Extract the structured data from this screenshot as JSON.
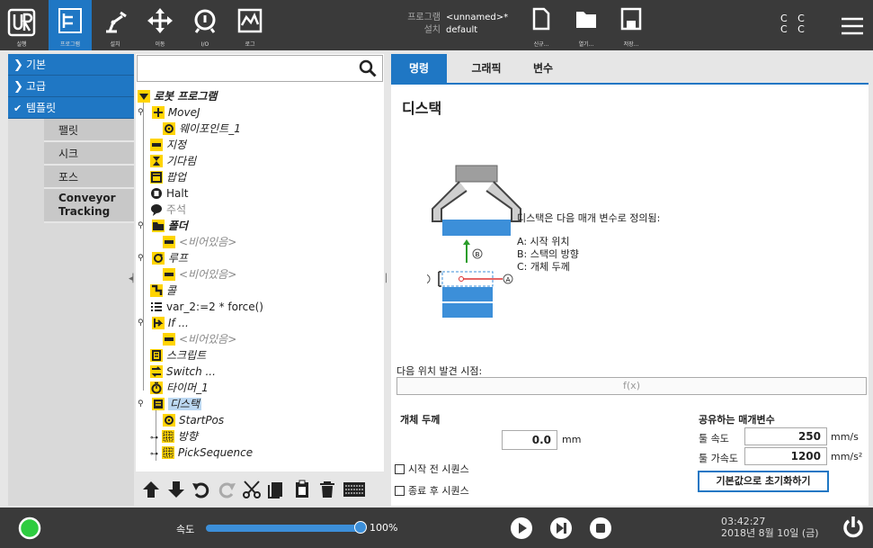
{
  "topbar": {
    "nav": [
      {
        "label": "실행",
        "icon": "ur-logo-icon"
      },
      {
        "label": "프로그램",
        "icon": "program-tree-icon"
      },
      {
        "label": "설치",
        "icon": "robot-arm-icon"
      },
      {
        "label": "이동",
        "icon": "move-arrows-icon"
      },
      {
        "label": "I/O",
        "icon": "io-icon"
      },
      {
        "label": "로그",
        "icon": "log-icon"
      }
    ],
    "program_key": "프로그램",
    "program_value": "<unnamed>*",
    "install_key": "설치",
    "install_value": "default",
    "new_label": "신규...",
    "open_label": "열기...",
    "save_label": "저장...",
    "mode_line1": "C C",
    "mode_line2": "C C"
  },
  "leftnav": {
    "sections": [
      "기본",
      "고급",
      "템플릿"
    ],
    "items": [
      "팰릿",
      "시크",
      "포스",
      "Conveyor Tracking"
    ]
  },
  "tree": {
    "search_placeholder": "",
    "nodes": [
      "로봇 프로그램",
      "MoveJ",
      "웨이포인트_1",
      "지정",
      "기다림",
      "팝업",
      "Halt",
      "주석",
      "폴더",
      "<비어있음>",
      "루프",
      "<비어있음>",
      "콜",
      "var_2:=2 * force()",
      "If ...",
      "<비어있음>",
      "스크립트",
      "Switch ...",
      "타이머_1",
      "디스택",
      "StartPos",
      "방향",
      "PickSequence"
    ]
  },
  "main": {
    "tabs": [
      "명령",
      "그래픽",
      "변수"
    ],
    "title": "디스택",
    "desc_title": "디스택은 다음 매개 변수로 정의됨:",
    "desc_a": "A: 시작 위치",
    "desc_b": "B: 스택의 방향",
    "desc_c": "C: 개체 두께",
    "diagram_labels": {
      "a": "A",
      "b": "B",
      "c": "C"
    },
    "next_pos_label": "다음 위치 발견 시점:",
    "expr_placeholder": "f(x)",
    "thickness_label": "개체 두께",
    "thickness_value": "0.0",
    "thickness_unit": "mm",
    "shared_label": "공유하는 매개변수",
    "tool_speed_label": "툴 속도",
    "tool_speed_value": "250",
    "tool_speed_unit": "mm/s",
    "tool_accel_label": "툴 가속도",
    "tool_accel_value": "1200",
    "tool_accel_unit": "mm/s²",
    "before_seq": "시작 전 시퀀스",
    "after_seq": "종료 후 시퀀스",
    "reset_button": "기본값으로 초기화하기"
  },
  "bottombar": {
    "speed_label": "속도",
    "speed_percent": "100%",
    "speed_fraction": 1.0,
    "time": "03:42:27",
    "date": "2018년 8월 10일 (금)"
  },
  "colors": {
    "accent": "#1f77c4",
    "yellow": "#ffd400",
    "dark": "#3a3a3a",
    "green": "#2ecc40"
  }
}
